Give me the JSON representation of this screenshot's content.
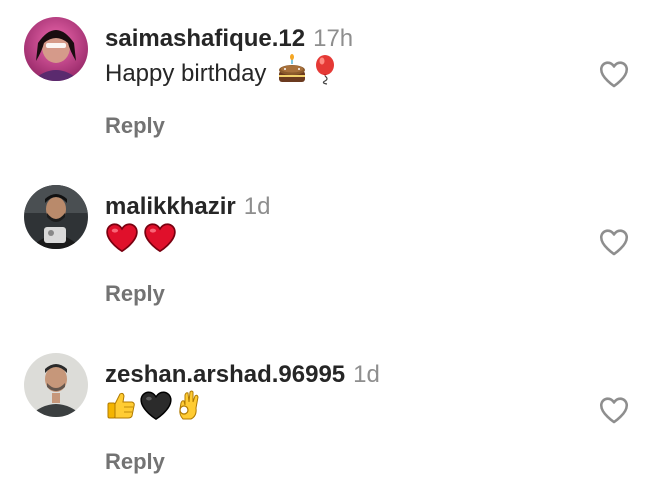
{
  "comments": [
    {
      "username": "saimashafique.12",
      "time": "17h",
      "text": "Happy birthday",
      "emojis": [
        "birthday-cake-emoji",
        "balloon-emoji"
      ],
      "reply_label": "Reply",
      "avatar_icon": "avatar-photo"
    },
    {
      "username": "malikkhazir",
      "time": "1d",
      "text": "",
      "emojis": [
        "red-heart-emoji",
        "red-heart-emoji"
      ],
      "reply_label": "Reply",
      "avatar_icon": "avatar-photo"
    },
    {
      "username": "zeshan.arshad.96995",
      "time": "1d",
      "text": "",
      "emojis": [
        "thumbs-up-emoji",
        "black-heart-emoji",
        "ok-hand-emoji"
      ],
      "reply_label": "Reply",
      "avatar_icon": "avatar-photo"
    }
  ],
  "icons": {
    "like": "heart-outline-icon"
  },
  "colors": {
    "username": "#262626",
    "time": "#8e8e8e",
    "reply": "#737373",
    "heart_outline": "#8e8e8e",
    "red_heart": "#e0102b"
  }
}
